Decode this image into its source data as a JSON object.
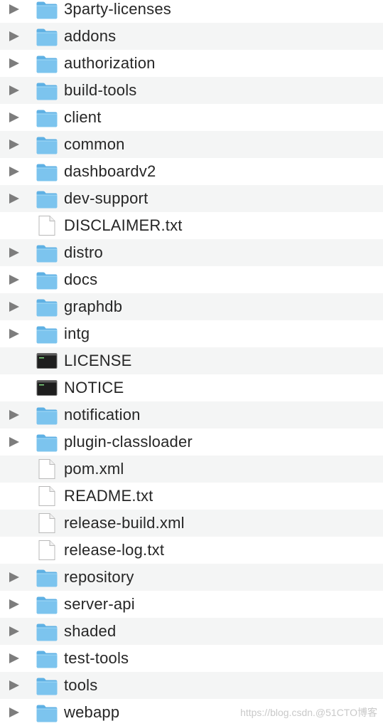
{
  "items": [
    {
      "name": "3party-licenses",
      "type": "folder"
    },
    {
      "name": "addons",
      "type": "folder"
    },
    {
      "name": "authorization",
      "type": "folder"
    },
    {
      "name": "build-tools",
      "type": "folder"
    },
    {
      "name": "client",
      "type": "folder"
    },
    {
      "name": "common",
      "type": "folder"
    },
    {
      "name": "dashboardv2",
      "type": "folder"
    },
    {
      "name": "dev-support",
      "type": "folder"
    },
    {
      "name": "DISCLAIMER.txt",
      "type": "document"
    },
    {
      "name": "distro",
      "type": "folder"
    },
    {
      "name": "docs",
      "type": "folder"
    },
    {
      "name": "graphdb",
      "type": "folder"
    },
    {
      "name": "intg",
      "type": "folder"
    },
    {
      "name": "LICENSE",
      "type": "terminal"
    },
    {
      "name": "NOTICE",
      "type": "terminal"
    },
    {
      "name": "notification",
      "type": "folder"
    },
    {
      "name": "plugin-classloader",
      "type": "folder"
    },
    {
      "name": "pom.xml",
      "type": "document"
    },
    {
      "name": "README.txt",
      "type": "document"
    },
    {
      "name": "release-build.xml",
      "type": "document"
    },
    {
      "name": "release-log.txt",
      "type": "document"
    },
    {
      "name": "repository",
      "type": "folder"
    },
    {
      "name": "server-api",
      "type": "folder"
    },
    {
      "name": "shaded",
      "type": "folder"
    },
    {
      "name": "test-tools",
      "type": "folder"
    },
    {
      "name": "tools",
      "type": "folder"
    },
    {
      "name": "webapp",
      "type": "folder"
    }
  ],
  "icons": {
    "folder": "folder-icon",
    "document": "document-icon",
    "terminal": "terminal-icon",
    "disclosure": "disclosure-triangle-icon"
  },
  "colors": {
    "folder_body": "#7cc4ee",
    "folder_tab": "#5fb1e4",
    "row_alt": "#f4f5f5",
    "text": "#262626",
    "triangle": "#7d7d7d"
  },
  "watermark": "https://blog.csdn.@51CTO博客"
}
